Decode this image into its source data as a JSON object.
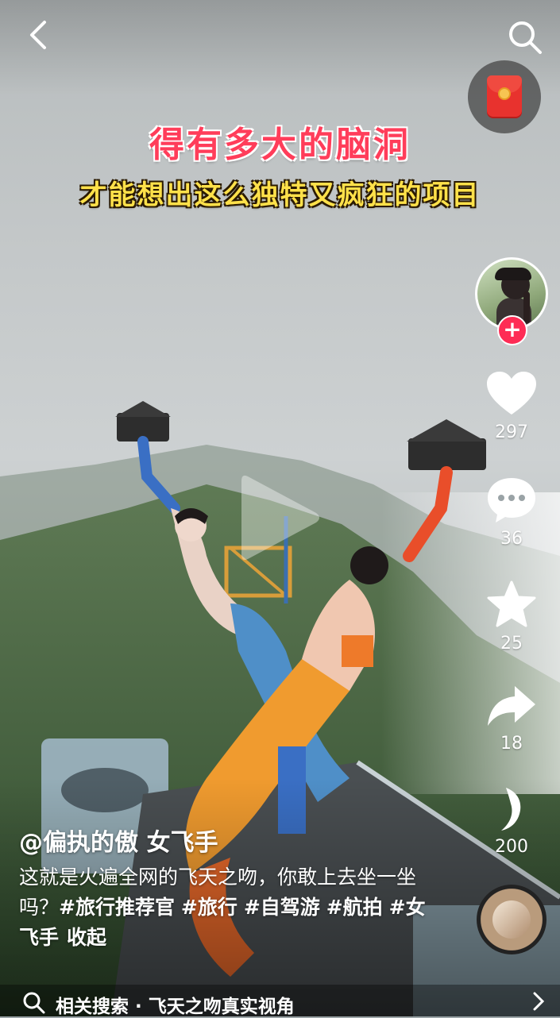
{
  "overlay_caption": {
    "line1": "得有多大的脑洞",
    "line2": "才能想出这么独特又疯狂的项目"
  },
  "sidebar_actions": {
    "like_count": "297",
    "comment_count": "36",
    "favorite_count": "25",
    "share_count": "18",
    "music_count": "200"
  },
  "post": {
    "author_handle": "@偏执的傲 女飞手",
    "description": "这就是火遍全网的飞天之吻，你敢上去坐一坐吗？",
    "hashtags": [
      "#旅行推荐官",
      "#旅行",
      "#自驾游",
      "#航拍",
      "#女飞手"
    ],
    "collapse_label": "收起"
  },
  "related_search": {
    "label": "相关搜索 · 飞天之吻真实视角"
  },
  "colors": {
    "follow_badge": "#fe2c55",
    "caption_red": "#ff3d5a",
    "caption_yellow": "#ffe14a"
  },
  "icons": [
    "back-arrow-icon",
    "search-icon",
    "red-packet-icon",
    "play-icon",
    "heart-icon",
    "comment-icon",
    "star-icon",
    "share-icon",
    "music-note-icon",
    "chevron-right-icon"
  ]
}
